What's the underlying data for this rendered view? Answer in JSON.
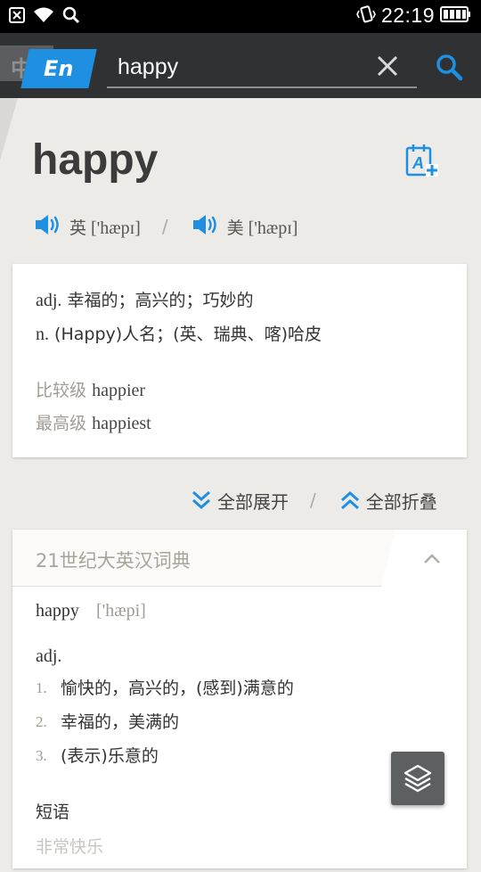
{
  "status_bar": {
    "time": "22:19",
    "left_icons": [
      "notification-close-icon",
      "wifi-icon",
      "search-icon"
    ],
    "right_icons": [
      "vibrate-icon",
      "battery-icon"
    ]
  },
  "top_bar": {
    "lang_zh_label": "中",
    "lang_en_label": "En",
    "search": {
      "value": "happy",
      "placeholder": ""
    },
    "clear_icon": "close-icon",
    "search_icon": "search-icon",
    "accent_color": "#1e8fe1"
  },
  "word": {
    "headword": "happy",
    "wordbook_icon": "add-to-wordbook-icon",
    "pronunciations": [
      {
        "region": "英",
        "phonetic": "['hæpɪ]"
      },
      {
        "region": "美",
        "phonetic": "['hæpɪ]"
      }
    ],
    "pron_separator": "/"
  },
  "basic_card": {
    "definitions": [
      {
        "pos": "adj.",
        "text": "幸福的；高兴的；巧妙的"
      },
      {
        "pos": "n.",
        "text": "(Happy)人名；(英、瑞典、喀)哈皮"
      }
    ],
    "forms": [
      {
        "label": "比较级",
        "value": "happier"
      },
      {
        "label": "最高级",
        "value": "happiest"
      }
    ]
  },
  "expand_controls": {
    "expand_all": "全部展开",
    "collapse_all": "全部折叠",
    "separator": "/"
  },
  "dict_card": {
    "title": "21世纪大英汉词典",
    "entry": "happy",
    "entry_phonetic": "['hæpi]",
    "pos": "adj.",
    "senses": [
      {
        "num": "1.",
        "text": "愉快的，高兴的，(感到)满意的"
      },
      {
        "num": "2.",
        "text": "幸福的，美满的"
      },
      {
        "num": "3.",
        "text": "(表示)乐意的"
      }
    ],
    "phrases_title": "短语",
    "phrase_peek": "非常快乐"
  },
  "floating_button_icon": "layers-icon"
}
